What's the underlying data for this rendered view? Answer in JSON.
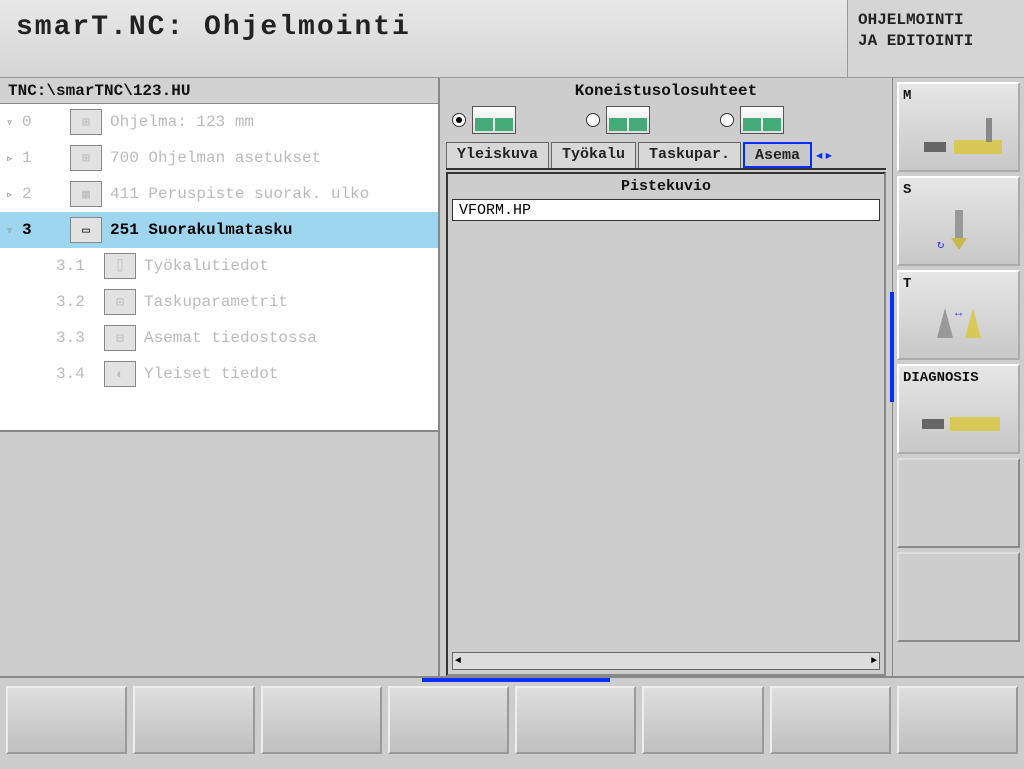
{
  "title": "smarT.NC: Ohjelmointi",
  "mode_line1": "OHJELMOINTI",
  "mode_line2": "JA EDITOINTI",
  "path": "TNC:\\smarTNC\\123.HU",
  "tree": [
    {
      "arrow": "▿",
      "num": "0",
      "icon": "⊞",
      "text": "Ohjelma: 123 mm"
    },
    {
      "arrow": "▹",
      "num": "1",
      "icon": "⊞",
      "text": "700 Ohjelman asetukset"
    },
    {
      "arrow": "▹",
      "num": "2",
      "icon": "▦",
      "text": "411 Peruspiste suorak. ulko"
    },
    {
      "arrow": "▿",
      "num": "3",
      "icon": "▭",
      "text": "251 Suorakulmatasku",
      "sel": true
    },
    {
      "arrow": "",
      "num": "3.1",
      "icon": "⌷",
      "text": "Työkalutiedot"
    },
    {
      "arrow": "",
      "num": "3.2",
      "icon": "⊡",
      "text": "Taskuparametrit"
    },
    {
      "arrow": "",
      "num": "3.3",
      "icon": "⊟",
      "text": "Asemat tiedostossa"
    },
    {
      "arrow": "",
      "num": "3.4",
      "icon": "◐",
      "text": "Yleiset tiedot"
    }
  ],
  "cond_title": "Koneistusolosuhteet",
  "tabs": [
    "Yleiskuva",
    "Työkalu",
    "Taskupar.",
    "Asema"
  ],
  "active_tab": 3,
  "content_label": "Pistekuvio",
  "content_value": "VFORM.HP",
  "side": [
    {
      "lbl": "M",
      "kind": "mill"
    },
    {
      "lbl": "S",
      "kind": "spindle"
    },
    {
      "lbl": "T",
      "kind": "tool"
    },
    {
      "lbl": "DIAGNOSIS",
      "kind": "diag"
    },
    {
      "lbl": "",
      "kind": "empty"
    },
    {
      "lbl": "",
      "kind": "empty"
    }
  ]
}
